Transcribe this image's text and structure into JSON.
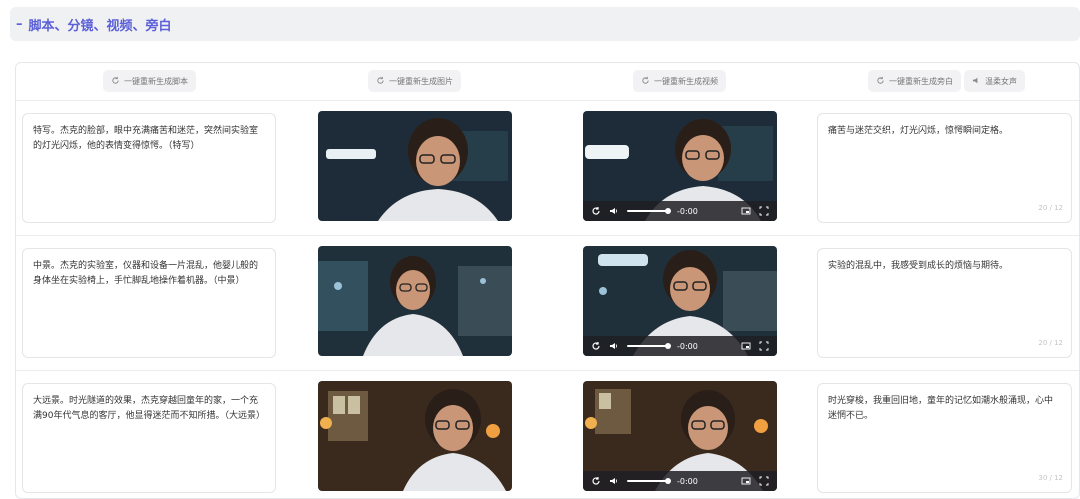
{
  "section": {
    "toggle": "–",
    "title": "脚本、分镜、视频、旁白"
  },
  "toolbar": {
    "regen_script": "一键重新生成脚本",
    "regen_images": "一键重新生成图片",
    "regen_videos": "一键重新生成视频",
    "regen_narration": "一键重新生成旁白",
    "voice": "温柔女声"
  },
  "rows": [
    {
      "script": "特写。杰克的脸部，眼中充满痛苦和迷茫，突然间实验室的灯光闪烁，他的表情变得惊愕。（特写）",
      "narration": "痛苦与迷茫交织，灯光闪烁，惊愕瞬间定格。",
      "counter": "20 / 12",
      "video_time": "-0:00"
    },
    {
      "script": "中景。杰克的实验室，仪器和设备一片混乱，他婴儿般的身体坐在实验椅上，手忙脚乱地操作着机器。（中景）",
      "narration": "实验的混乱中，我感受到成长的烦恼与期待。",
      "counter": "20 / 12",
      "video_time": "-0:00"
    },
    {
      "script": "大远景。时光隧道的效果，杰克穿越回童年的家，一个充满90年代气息的客厅，他显得迷茫而不知所措。（大远景）",
      "narration": "时光穿梭，我重回旧地，童年的记忆如潮水般涌现，心中迷惘不已。",
      "counter": "30 / 12",
      "video_time": "-0:00"
    }
  ],
  "colors": {
    "accent": "#5b5fd8",
    "header_bg": "#f0f1f3"
  }
}
